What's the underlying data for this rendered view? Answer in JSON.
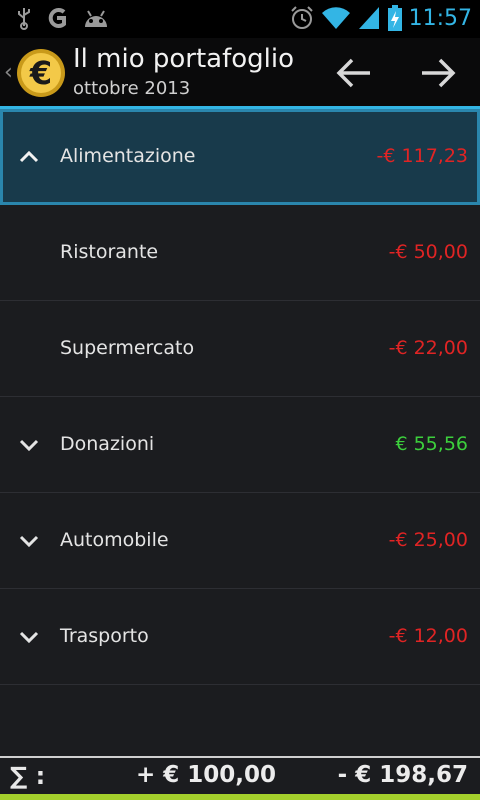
{
  "status_bar": {
    "time": "11:57",
    "icons": [
      "usb-icon",
      "g-icon",
      "android-icon",
      "alarm-icon",
      "wifi-icon",
      "signal-icon",
      "battery-charging-icon"
    ]
  },
  "action_bar": {
    "title": "Il mio portafoglio",
    "subtitle": "ottobre 2013",
    "app_icon_symbol": "€",
    "prev_icon": "arrow-left-icon",
    "next_icon": "arrow-right-icon"
  },
  "categories": [
    {
      "label": "Alimentazione",
      "amount": "-€ 117,23",
      "sign": "negative",
      "state": "expanded",
      "selected": true
    },
    {
      "label": "Ristorante",
      "amount": "-€ 50,00",
      "sign": "negative",
      "state": "child"
    },
    {
      "label": "Supermercato",
      "amount": "-€ 22,00",
      "sign": "negative",
      "state": "child"
    },
    {
      "label": "Donazioni",
      "amount": "€ 55,56",
      "sign": "positive",
      "state": "collapsed"
    },
    {
      "label": "Automobile",
      "amount": "-€ 25,00",
      "sign": "negative",
      "state": "collapsed"
    },
    {
      "label": "Trasporto",
      "amount": "-€ 12,00",
      "sign": "negative",
      "state": "collapsed"
    }
  ],
  "footer": {
    "sigma_label": "∑ :",
    "total_income": "+ € 100,00",
    "total_expense": "- € 198,67"
  },
  "colors": {
    "accent": "#33b5e5",
    "negative": "#e02424",
    "positive": "#3ccf3c",
    "footer_accent": "#a4cf2c"
  }
}
